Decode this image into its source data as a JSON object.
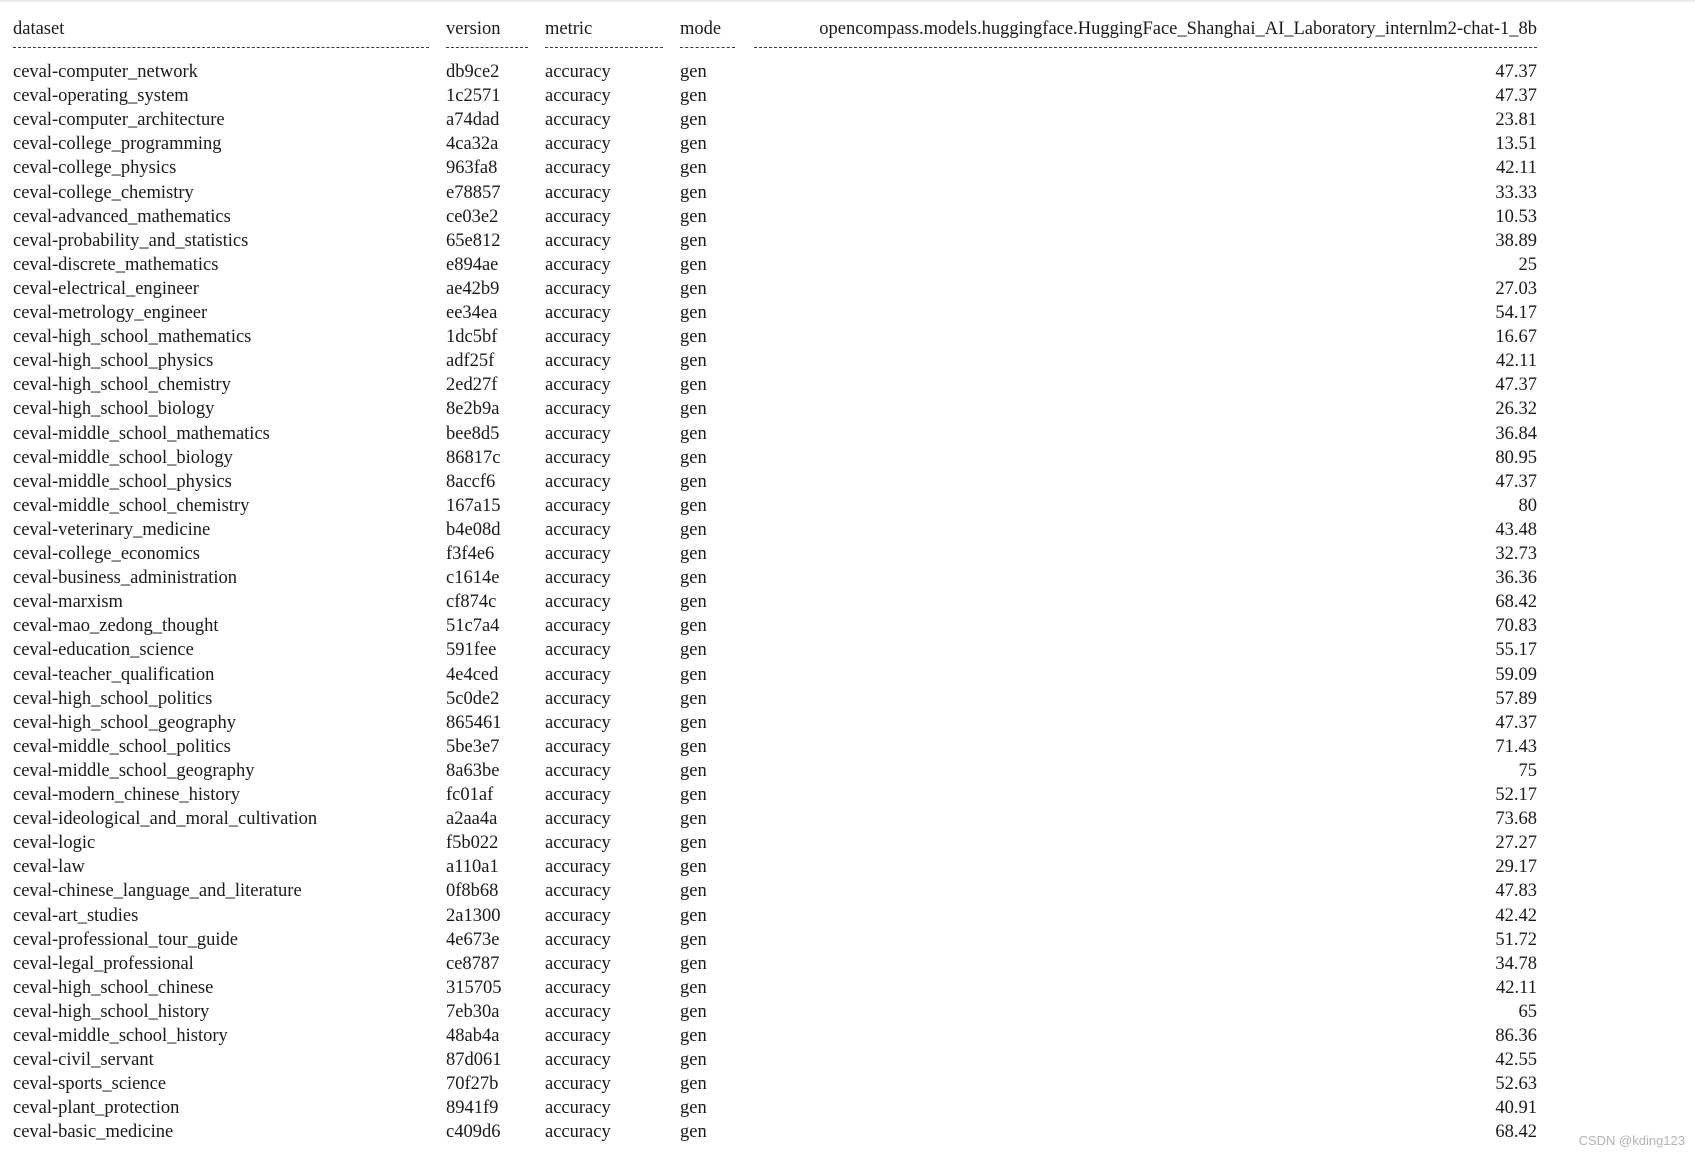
{
  "table": {
    "headers": {
      "dataset": "dataset",
      "version": "version",
      "metric": "metric",
      "mode": "mode",
      "model": "opencompass.models.huggingface.HuggingFace_Shanghai_AI_Laboratory_internlm2-chat-1_8b"
    },
    "rows": [
      {
        "dataset": "ceval-computer_network",
        "version": "db9ce2",
        "metric": "accuracy",
        "mode": "gen",
        "score": "47.37"
      },
      {
        "dataset": "ceval-operating_system",
        "version": "1c2571",
        "metric": "accuracy",
        "mode": "gen",
        "score": "47.37"
      },
      {
        "dataset": "ceval-computer_architecture",
        "version": "a74dad",
        "metric": "accuracy",
        "mode": "gen",
        "score": "23.81"
      },
      {
        "dataset": "ceval-college_programming",
        "version": "4ca32a",
        "metric": "accuracy",
        "mode": "gen",
        "score": "13.51"
      },
      {
        "dataset": "ceval-college_physics",
        "version": "963fa8",
        "metric": "accuracy",
        "mode": "gen",
        "score": "42.11"
      },
      {
        "dataset": "ceval-college_chemistry",
        "version": "e78857",
        "metric": "accuracy",
        "mode": "gen",
        "score": "33.33"
      },
      {
        "dataset": "ceval-advanced_mathematics",
        "version": "ce03e2",
        "metric": "accuracy",
        "mode": "gen",
        "score": "10.53"
      },
      {
        "dataset": "ceval-probability_and_statistics",
        "version": "65e812",
        "metric": "accuracy",
        "mode": "gen",
        "score": "38.89"
      },
      {
        "dataset": "ceval-discrete_mathematics",
        "version": "e894ae",
        "metric": "accuracy",
        "mode": "gen",
        "score": "25"
      },
      {
        "dataset": "ceval-electrical_engineer",
        "version": "ae42b9",
        "metric": "accuracy",
        "mode": "gen",
        "score": "27.03"
      },
      {
        "dataset": "ceval-metrology_engineer",
        "version": "ee34ea",
        "metric": "accuracy",
        "mode": "gen",
        "score": "54.17"
      },
      {
        "dataset": "ceval-high_school_mathematics",
        "version": "1dc5bf",
        "metric": "accuracy",
        "mode": "gen",
        "score": "16.67"
      },
      {
        "dataset": "ceval-high_school_physics",
        "version": "adf25f",
        "metric": "accuracy",
        "mode": "gen",
        "score": "42.11"
      },
      {
        "dataset": "ceval-high_school_chemistry",
        "version": "2ed27f",
        "metric": "accuracy",
        "mode": "gen",
        "score": "47.37"
      },
      {
        "dataset": "ceval-high_school_biology",
        "version": "8e2b9a",
        "metric": "accuracy",
        "mode": "gen",
        "score": "26.32"
      },
      {
        "dataset": "ceval-middle_school_mathematics",
        "version": "bee8d5",
        "metric": "accuracy",
        "mode": "gen",
        "score": "36.84"
      },
      {
        "dataset": "ceval-middle_school_biology",
        "version": "86817c",
        "metric": "accuracy",
        "mode": "gen",
        "score": "80.95"
      },
      {
        "dataset": "ceval-middle_school_physics",
        "version": "8accf6",
        "metric": "accuracy",
        "mode": "gen",
        "score": "47.37"
      },
      {
        "dataset": "ceval-middle_school_chemistry",
        "version": "167a15",
        "metric": "accuracy",
        "mode": "gen",
        "score": "80"
      },
      {
        "dataset": "ceval-veterinary_medicine",
        "version": "b4e08d",
        "metric": "accuracy",
        "mode": "gen",
        "score": "43.48"
      },
      {
        "dataset": "ceval-college_economics",
        "version": "f3f4e6",
        "metric": "accuracy",
        "mode": "gen",
        "score": "32.73"
      },
      {
        "dataset": "ceval-business_administration",
        "version": "c1614e",
        "metric": "accuracy",
        "mode": "gen",
        "score": "36.36"
      },
      {
        "dataset": "ceval-marxism",
        "version": "cf874c",
        "metric": "accuracy",
        "mode": "gen",
        "score": "68.42"
      },
      {
        "dataset": "ceval-mao_zedong_thought",
        "version": "51c7a4",
        "metric": "accuracy",
        "mode": "gen",
        "score": "70.83"
      },
      {
        "dataset": "ceval-education_science",
        "version": "591fee",
        "metric": "accuracy",
        "mode": "gen",
        "score": "55.17"
      },
      {
        "dataset": "ceval-teacher_qualification",
        "version": "4e4ced",
        "metric": "accuracy",
        "mode": "gen",
        "score": "59.09"
      },
      {
        "dataset": "ceval-high_school_politics",
        "version": "5c0de2",
        "metric": "accuracy",
        "mode": "gen",
        "score": "57.89"
      },
      {
        "dataset": "ceval-high_school_geography",
        "version": "865461",
        "metric": "accuracy",
        "mode": "gen",
        "score": "47.37"
      },
      {
        "dataset": "ceval-middle_school_politics",
        "version": "5be3e7",
        "metric": "accuracy",
        "mode": "gen",
        "score": "71.43"
      },
      {
        "dataset": "ceval-middle_school_geography",
        "version": "8a63be",
        "metric": "accuracy",
        "mode": "gen",
        "score": "75"
      },
      {
        "dataset": "ceval-modern_chinese_history",
        "version": "fc01af",
        "metric": "accuracy",
        "mode": "gen",
        "score": "52.17"
      },
      {
        "dataset": "ceval-ideological_and_moral_cultivation",
        "version": "a2aa4a",
        "metric": "accuracy",
        "mode": "gen",
        "score": "73.68"
      },
      {
        "dataset": "ceval-logic",
        "version": "f5b022",
        "metric": "accuracy",
        "mode": "gen",
        "score": "27.27"
      },
      {
        "dataset": "ceval-law",
        "version": "a110a1",
        "metric": "accuracy",
        "mode": "gen",
        "score": "29.17"
      },
      {
        "dataset": "ceval-chinese_language_and_literature",
        "version": "0f8b68",
        "metric": "accuracy",
        "mode": "gen",
        "score": "47.83"
      },
      {
        "dataset": "ceval-art_studies",
        "version": "2a1300",
        "metric": "accuracy",
        "mode": "gen",
        "score": "42.42"
      },
      {
        "dataset": "ceval-professional_tour_guide",
        "version": "4e673e",
        "metric": "accuracy",
        "mode": "gen",
        "score": "51.72"
      },
      {
        "dataset": "ceval-legal_professional",
        "version": "ce8787",
        "metric": "accuracy",
        "mode": "gen",
        "score": "34.78"
      },
      {
        "dataset": "ceval-high_school_chinese",
        "version": "315705",
        "metric": "accuracy",
        "mode": "gen",
        "score": "42.11"
      },
      {
        "dataset": "ceval-high_school_history",
        "version": "7eb30a",
        "metric": "accuracy",
        "mode": "gen",
        "score": "65"
      },
      {
        "dataset": "ceval-middle_school_history",
        "version": "48ab4a",
        "metric": "accuracy",
        "mode": "gen",
        "score": "86.36"
      },
      {
        "dataset": "ceval-civil_servant",
        "version": "87d061",
        "metric": "accuracy",
        "mode": "gen",
        "score": "42.55"
      },
      {
        "dataset": "ceval-sports_science",
        "version": "70f27b",
        "metric": "accuracy",
        "mode": "gen",
        "score": "52.63"
      },
      {
        "dataset": "ceval-plant_protection",
        "version": "8941f9",
        "metric": "accuracy",
        "mode": "gen",
        "score": "40.91"
      },
      {
        "dataset": "ceval-basic_medicine",
        "version": "c409d6",
        "metric": "accuracy",
        "mode": "gen",
        "score": "68.42"
      }
    ]
  },
  "watermark": "CSDN @kding123"
}
